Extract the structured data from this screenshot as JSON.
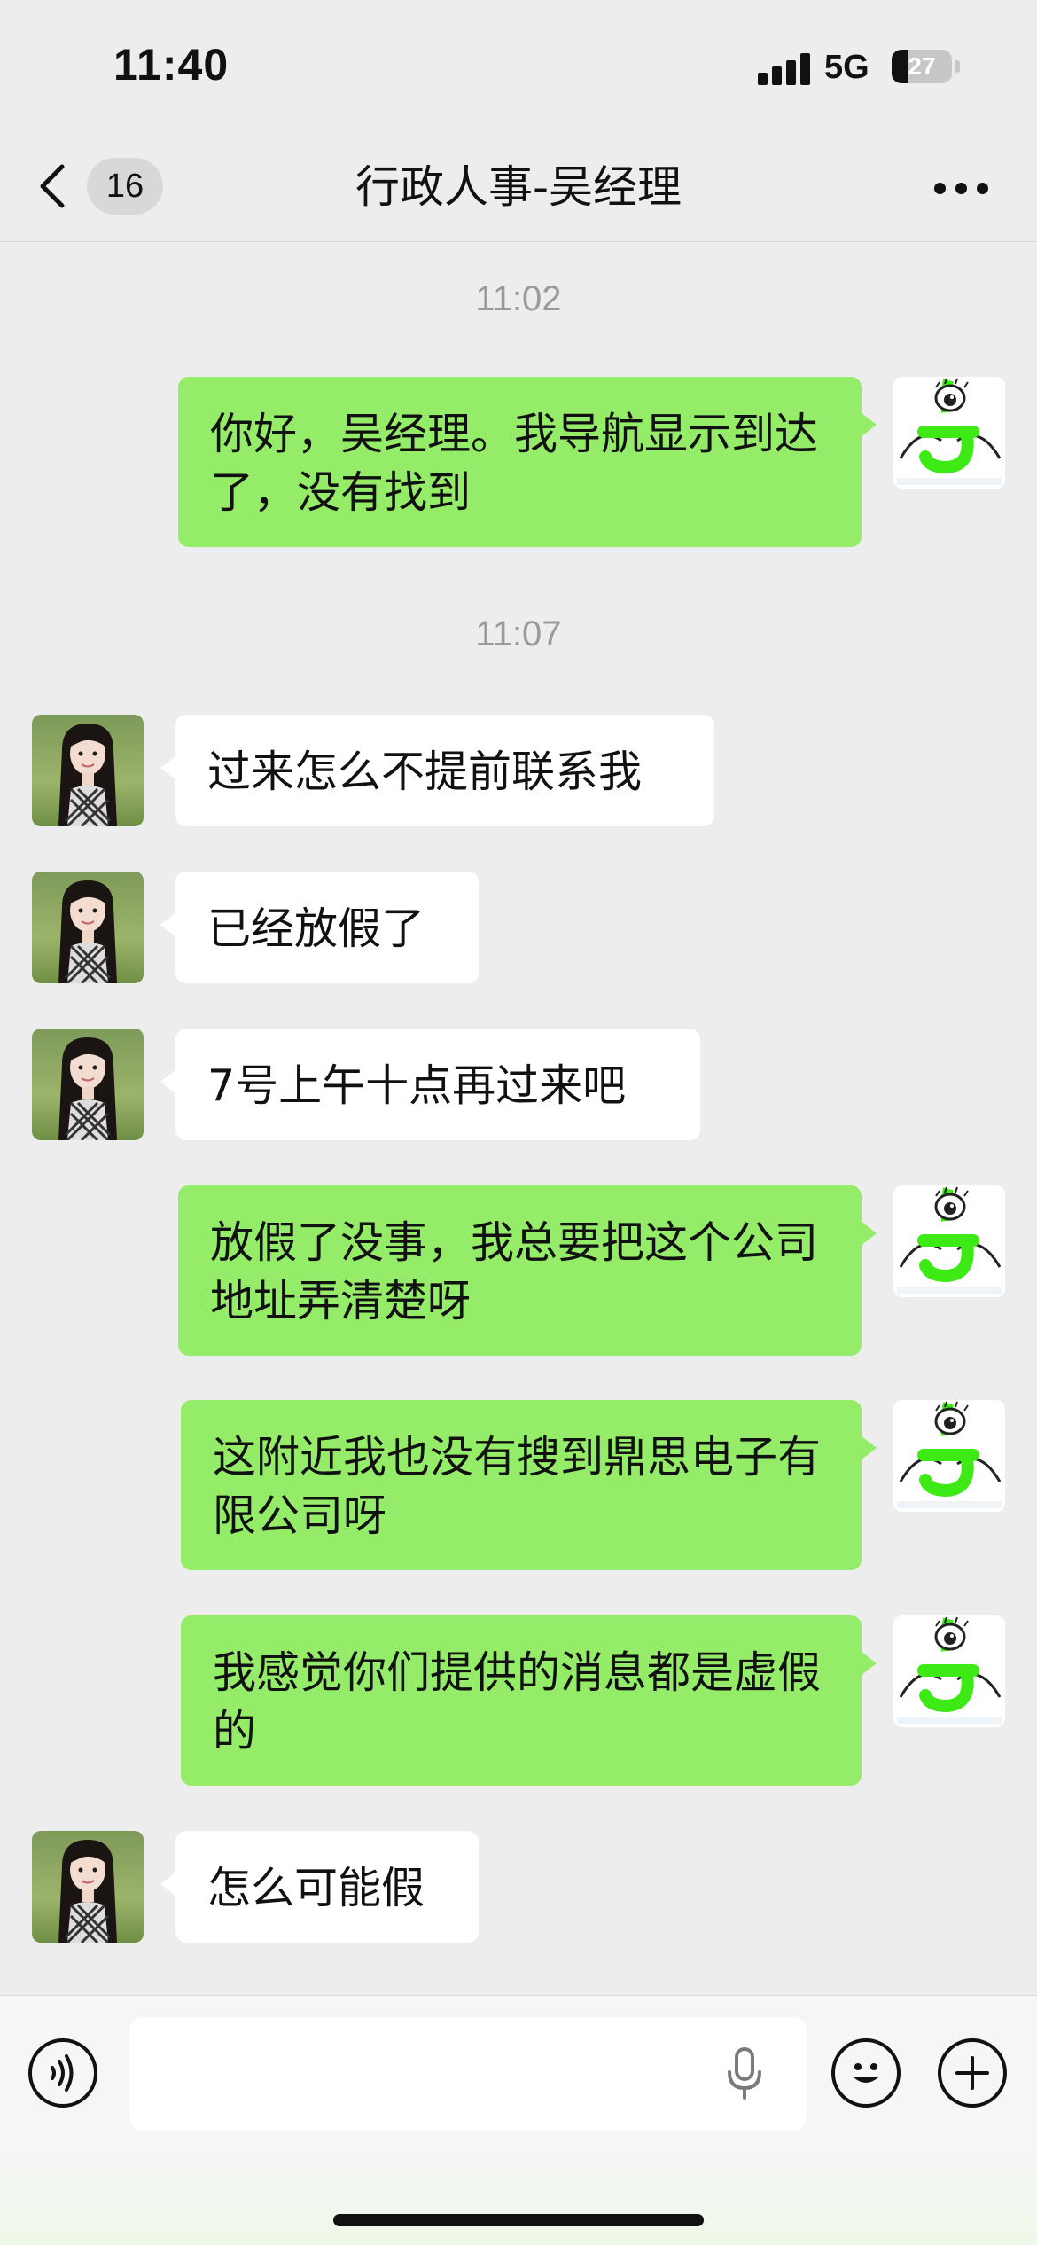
{
  "status_bar": {
    "time": "11:40",
    "network": "5G",
    "battery_level": "27",
    "battery_fraction": 0.27,
    "signal_icon": "cellular-signal-icon",
    "battery_icon": "battery-icon"
  },
  "nav": {
    "back_icon": "chevron-left-icon",
    "unread_count": "16",
    "title": "行政人事-吴经理",
    "more_icon": "more-dots-icon"
  },
  "messages": [
    {
      "type": "time",
      "text": "11:02"
    },
    {
      "type": "msg",
      "from": "me",
      "text": "你好，吴经理。我导航显示到达了，没有找到"
    },
    {
      "type": "time",
      "text": "11:07"
    },
    {
      "type": "msg",
      "from": "them",
      "text": "过来怎么不提前联系我"
    },
    {
      "type": "msg",
      "from": "them",
      "text": "已经放假了"
    },
    {
      "type": "msg",
      "from": "them",
      "text": "7号上午十点再过来吧"
    },
    {
      "type": "msg",
      "from": "me",
      "text": "放假了没事，我总要把这个公司地址弄清楚呀"
    },
    {
      "type": "msg",
      "from": "me",
      "text": "这附近我也没有搜到鼎思电子有限公司呀"
    },
    {
      "type": "msg",
      "from": "me",
      "text": "我感觉你们提供的消息都是虚假的"
    },
    {
      "type": "msg",
      "from": "them",
      "text": "怎么可能假"
    }
  ],
  "input_bar": {
    "voice_icon": "voice-mode-icon",
    "input_value": "",
    "mic_icon": "microphone-icon",
    "emoji_icon": "emoji-icon",
    "plus_icon": "plus-icon"
  },
  "colors": {
    "background": "#ededed",
    "my_bubble": "#95ec69",
    "their_bubble": "#ffffff",
    "timestamp_text": "#9a9a9a",
    "my_avatar_green": "#3dea16"
  }
}
